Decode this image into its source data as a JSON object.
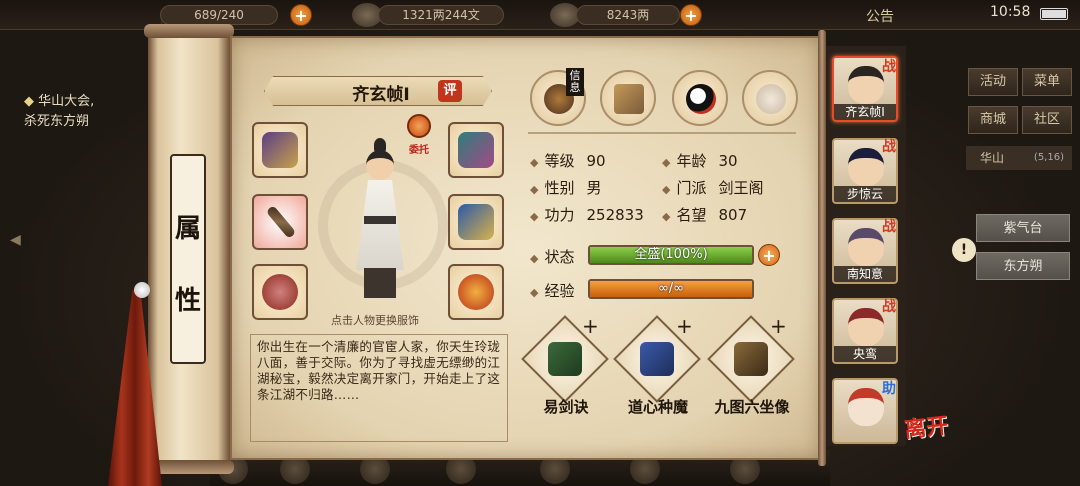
{
  "topbar": {
    "stamina": "689/240",
    "silver": "1321两244文",
    "gold": "8243两",
    "announcement": "公告",
    "time": "10:58"
  },
  "left_quest": {
    "title": "华山大会,",
    "desc": "杀死东方朔"
  },
  "right_menu": {
    "activity": "活动",
    "menu": "菜单",
    "shop": "商城",
    "community": "社区",
    "location": "华山",
    "coords": "(5,16)",
    "targets": [
      "紫气台",
      "东方朔"
    ]
  },
  "scroll": {
    "title_chars": [
      "属",
      "性"
    ]
  },
  "character": {
    "name": "齐玄帧Ⅰ",
    "rate_badge": "评",
    "entrust_label": "委托",
    "hint": "点击人物更换服饰",
    "bio": "你出生在一个清廉的官宦人家，你天生玲珑八面，善于交际。你为了寻找虚无缥缈的江湖秘宝，毅然决定离开家门，开始走上了这条江湖不归路……"
  },
  "top_icons": [
    {
      "name": "info",
      "tag": "信息"
    },
    {
      "name": "map",
      "tag": ""
    },
    {
      "name": "bagua",
      "tag": ""
    },
    {
      "name": "meridian",
      "tag": ""
    }
  ],
  "stats": {
    "level_label": "等级",
    "level": "90",
    "age_label": "年龄",
    "age": "30",
    "gender_label": "性别",
    "gender": "男",
    "sect_label": "门派",
    "sect": "剑王阁",
    "power_label": "功力",
    "power": "252833",
    "fame_label": "名望",
    "fame": "807",
    "status_label": "状态",
    "status": "全盛(100%)",
    "status_fraction": 1.0,
    "exp_label": "经验",
    "exp": "∞/∞",
    "exp_fraction": 1.0
  },
  "skills": [
    {
      "name": "易剑诀"
    },
    {
      "name": "道心种魔"
    },
    {
      "name": "九图六坐像"
    }
  ],
  "roster": [
    {
      "name": "齐玄帧Ⅰ",
      "tag": "战",
      "active": true
    },
    {
      "name": "步惊云",
      "tag": "战",
      "active": false
    },
    {
      "name": "南知意",
      "tag": "战",
      "active": false
    },
    {
      "name": "央鸾",
      "tag": "战",
      "active": false
    },
    {
      "name": "",
      "tag": "助",
      "active": false
    }
  ],
  "leave_label": "离开",
  "colors": {
    "status_fill": "#6aa52a",
    "exp_fill": "#e0801e",
    "accent_red": "#d63a20"
  }
}
